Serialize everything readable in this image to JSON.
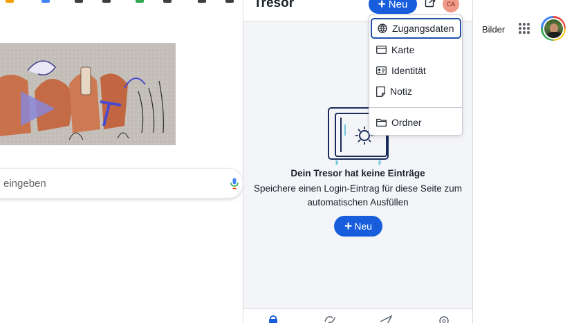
{
  "google": {
    "search_placeholder": "eingeben",
    "nav_separator": "l",
    "images_label": "Bilder"
  },
  "vault": {
    "title": "Tresor",
    "new_button": "Neu",
    "user_initials": "CA",
    "menu": [
      {
        "label": "Zugangsdaten",
        "icon": "globe-icon"
      },
      {
        "label": "Karte",
        "icon": "card-icon"
      },
      {
        "label": "Identität",
        "icon": "id-card-icon"
      },
      {
        "label": "Notiz",
        "icon": "note-icon"
      },
      {
        "label": "Ordner",
        "icon": "folder-icon"
      }
    ],
    "empty_title": "Dein Tresor hat keine Einträge",
    "empty_desc_line1": "Speichere einen Login-Eintrag für diese Seite zum",
    "empty_desc_line2": "automatischen Ausfüllen",
    "empty_new_button": "Neu",
    "bottom_nav": [
      "vault-icon",
      "generator-icon",
      "send-icon",
      "settings-icon"
    ],
    "colors": {
      "accent": "#175ddc",
      "focus_ring": "#1f4fa8",
      "panel_bg": "#f4f5f8"
    }
  }
}
